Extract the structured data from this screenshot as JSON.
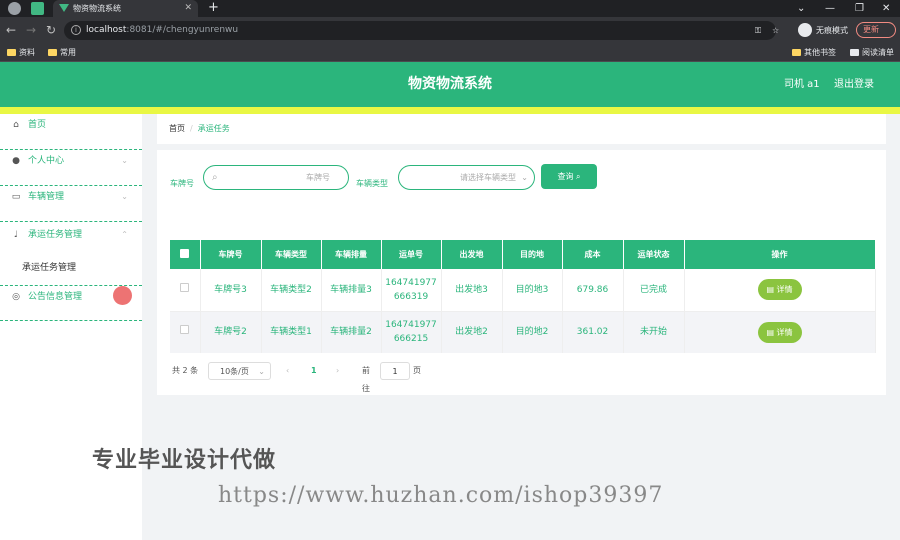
{
  "browser": {
    "tab_title": "物资物流系统",
    "new_tab": "+",
    "url_host": "localhost",
    "url_rest": ":8081/#/chengyunrenwu",
    "incognito_label": "无痕模式",
    "update_label": "更新",
    "bookmarks": [
      "资料",
      "常用"
    ],
    "bookmarks_right": [
      "其他书签",
      "阅读清单"
    ],
    "window_controls": [
      "⌄",
      "—",
      "❐",
      "✕"
    ]
  },
  "header": {
    "title": "物资物流系统",
    "user": "司机 a1",
    "logout": "退出登录"
  },
  "sidebar": {
    "items": [
      {
        "label": "首页",
        "icon": "home-icon"
      },
      {
        "label": "个人中心",
        "icon": "user-icon"
      },
      {
        "label": "车辆管理",
        "icon": "chat-icon"
      },
      {
        "label": "承运任务管理",
        "icon": "mic-icon"
      },
      {
        "label": "公告信息管理",
        "icon": "compass-icon"
      }
    ],
    "sub_item": "承运任务管理"
  },
  "breadcrumb": {
    "home": "首页",
    "separator": "/",
    "current": "承运任务"
  },
  "search": {
    "plate_label": "车牌号",
    "plate_placeholder": "车牌号",
    "type_label": "车辆类型",
    "type_placeholder": "请选择车辆类型",
    "query_button": "查询"
  },
  "table": {
    "headers": [
      "车牌号",
      "车辆类型",
      "车辆排量",
      "运单号",
      "出发地",
      "目的地",
      "成本",
      "运单状态",
      "操作"
    ],
    "rows": [
      {
        "plate": "车牌号3",
        "type": "车辆类型2",
        "displacement": "车辆排量3",
        "waybill_1": "164741977",
        "waybill_2": "666319",
        "from": "出发地3",
        "to": "目的地3",
        "cost": "679.86",
        "status": "已完成",
        "action": "详情"
      },
      {
        "plate": "车牌号2",
        "type": "车辆类型1",
        "displacement": "车辆排量2",
        "waybill_1": "164741977",
        "waybill_2": "666215",
        "from": "出发地2",
        "to": "目的地2",
        "cost": "361.02",
        "status": "未开始",
        "action": "详情"
      }
    ]
  },
  "pager": {
    "total": "共 2 条",
    "page_size": "10条/页",
    "prev": "‹",
    "current_page": "1",
    "next": "›",
    "goto_label": "前往",
    "goto_value": "1",
    "page_suffix": "页"
  },
  "watermark": {
    "line1": "专业毕业设计代做",
    "line2": "https://www.huzhan.com/ishop39397"
  },
  "colors": {
    "primary": "#2bb57c",
    "accent_bar": "#e9f744",
    "detail_button": "#8bc43f"
  }
}
